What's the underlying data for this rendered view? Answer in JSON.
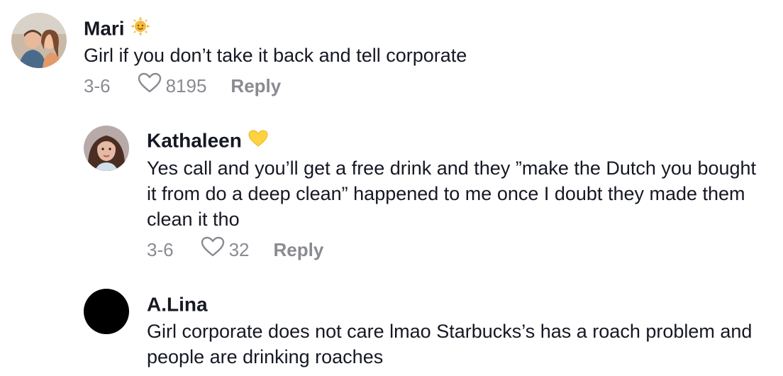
{
  "comments": [
    {
      "username": "Mari",
      "badge": "sun-emoji",
      "text": "Girl if you don’t take it back and tell corporate",
      "date": "3-6",
      "likes": "8195",
      "reply_label": "Reply"
    },
    {
      "username": "Kathaleen",
      "badge": "yellow-heart-emoji",
      "text": "Yes call and you’ll get a free drink and they ”make the Dutch you bought it from do a deep clean” happened to me once I doubt they made them clean it tho",
      "date": "3-6",
      "likes": "32",
      "reply_label": "Reply"
    },
    {
      "username": "A.Lina",
      "text": "Girl corporate does not care lmao Starbucks’s has a roach problem and people are drinking roaches"
    }
  ],
  "colors": {
    "text_primary": "#161823",
    "text_secondary": "#8a8b91",
    "sun": "#f6b93b",
    "yellow_heart": "#ffd23f"
  }
}
